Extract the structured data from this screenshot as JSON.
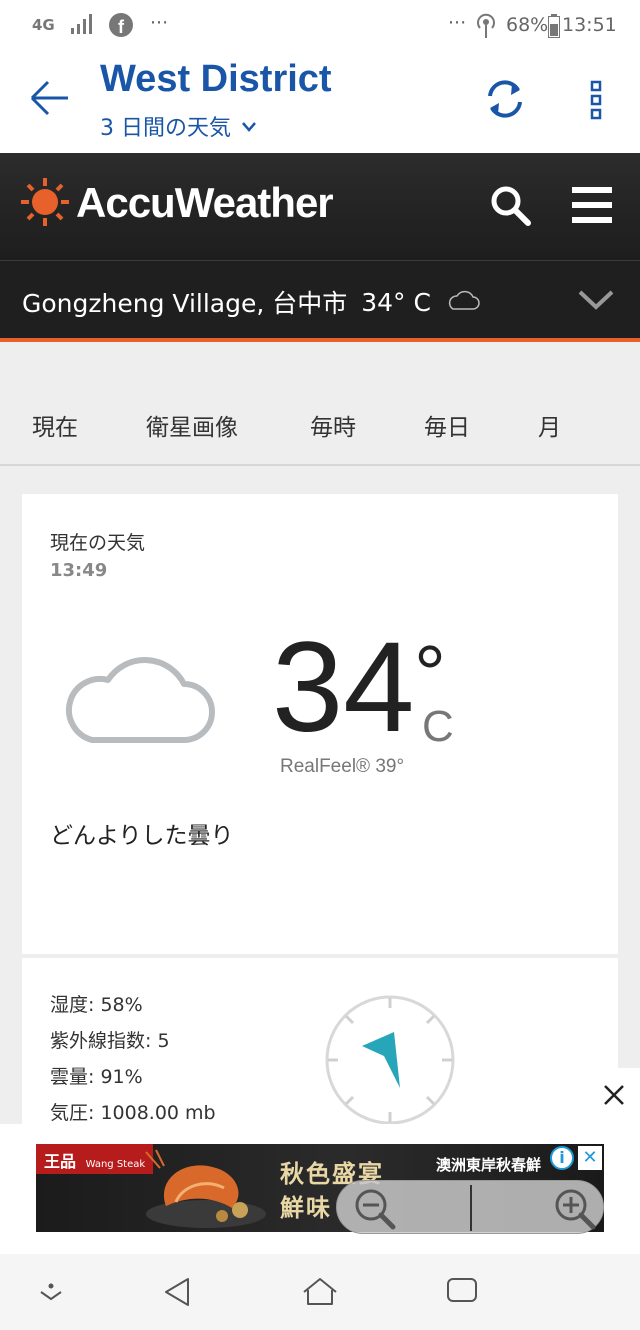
{
  "status_bar": {
    "network": "4G",
    "dots": "···",
    "dots_right": "···",
    "battery": "68%",
    "time": "13:51"
  },
  "header": {
    "title": "West District",
    "subtitle": "3 日間の天気",
    "icons": [
      "back-arrow-icon",
      "refresh-icon",
      "more-vert-icon"
    ]
  },
  "brand": {
    "name": "AccuWeather",
    "accent": "#e8612a"
  },
  "location": {
    "name": "Gongzheng Village, 台中市",
    "temp": "34° C"
  },
  "tabs": [
    "現在",
    "衛星画像",
    "毎時",
    "毎日",
    "月"
  ],
  "current": {
    "title": "現在の天気",
    "time": "13:49",
    "temp": "34",
    "deg": "°",
    "unit": "C",
    "realfeel": "RealFeel® 39°",
    "condition": "どんよりした曇り"
  },
  "details": [
    "湿度: 58%",
    "紫外線指数: 5",
    "雲量: 91%",
    "気圧: 1008.00 mb"
  ],
  "ad": {
    "brand": "王品",
    "brand_sub": "Wang Steak",
    "line1": "秋色盛宴",
    "line2": "鮮味",
    "line3": "澳洲東岸秋春鮮",
    "close": "✕"
  },
  "colors": {
    "title_blue": "#1a56a8",
    "dark_bar": "#1f1f1f",
    "accent_teal": "#26a6b8"
  }
}
